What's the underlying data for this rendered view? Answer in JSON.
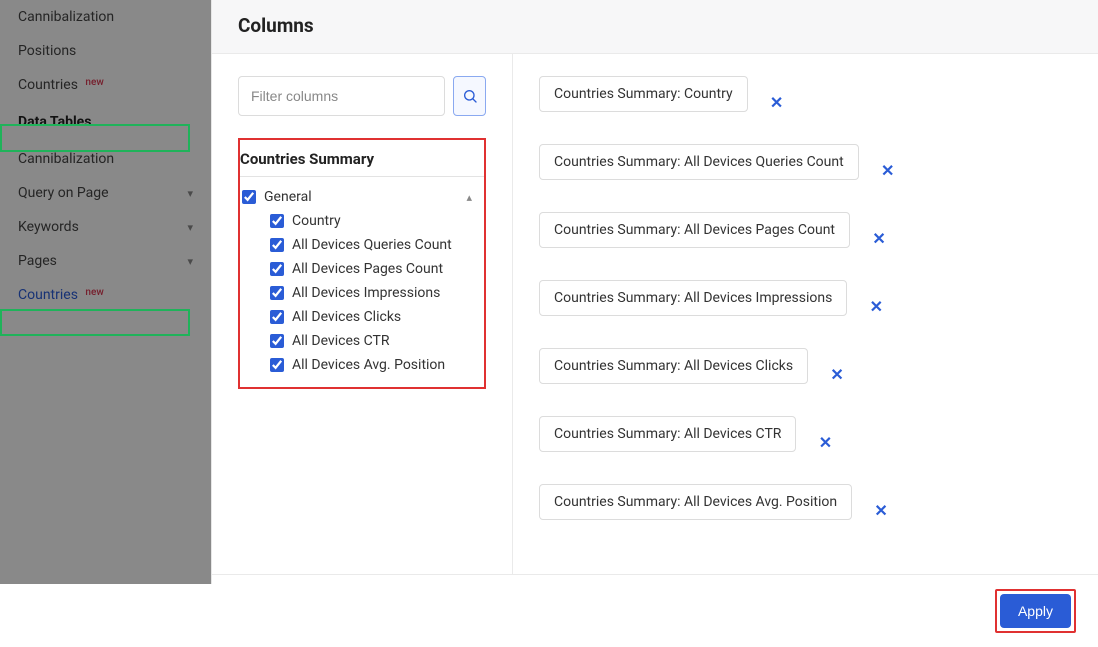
{
  "sidebar": {
    "items": [
      {
        "label": "Cannibalization",
        "badge": ""
      },
      {
        "label": "Positions",
        "badge": ""
      },
      {
        "label": "Countries",
        "badge": "new"
      }
    ],
    "section_header": "Data Tables",
    "section_items": [
      {
        "label": "Cannibalization",
        "expandable": false
      },
      {
        "label": "Query on Page",
        "expandable": true
      },
      {
        "label": "Keywords",
        "expandable": true
      },
      {
        "label": "Pages",
        "expandable": true
      },
      {
        "label": "Countries",
        "badge": "new",
        "active": true
      }
    ]
  },
  "panel": {
    "title": "Columns",
    "search_placeholder": "Filter columns",
    "tree_title": "Countries Summary",
    "general_label": "General",
    "columns": [
      "Country",
      "All Devices Queries Count",
      "All Devices Pages Count",
      "All Devices Impressions",
      "All Devices Clicks",
      "All Devices CTR",
      "All Devices Avg. Position"
    ]
  },
  "selected": [
    "Countries Summary: Country",
    "Countries Summary: All Devices Queries Count",
    "Countries Summary: All Devices Pages Count",
    "Countries Summary: All Devices Impressions",
    "Countries Summary: All Devices Clicks",
    "Countries Summary: All Devices CTR",
    "Countries Summary: All Devices Avg. Position"
  ],
  "footer": {
    "apply_label": "Apply"
  }
}
